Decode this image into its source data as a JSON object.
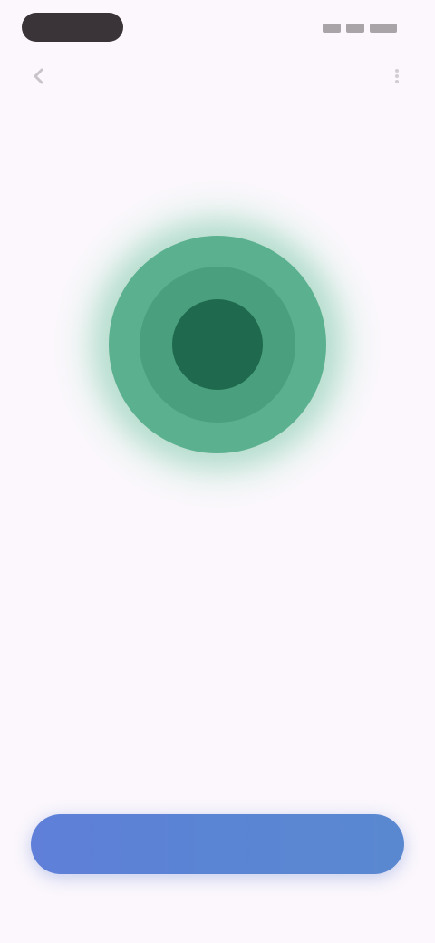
{
  "status_bar": {
    "time": "",
    "icons": [
      "signal-icon",
      "wifi-icon",
      "battery-icon"
    ]
  },
  "top_bar": {
    "back_icon": "back-arrow-icon",
    "title": "",
    "more_icon": "more-icon"
  },
  "pulse": {
    "colors": {
      "inner": "#1f6a4e",
      "middle": "#4a9f7e",
      "outer": "#5bb08f",
      "halo": "#d6eee4"
    }
  },
  "status_message": "",
  "primary_button": {
    "label": "",
    "color": "#5f7fd8"
  },
  "theme": {
    "background": "#fbf7fc"
  }
}
